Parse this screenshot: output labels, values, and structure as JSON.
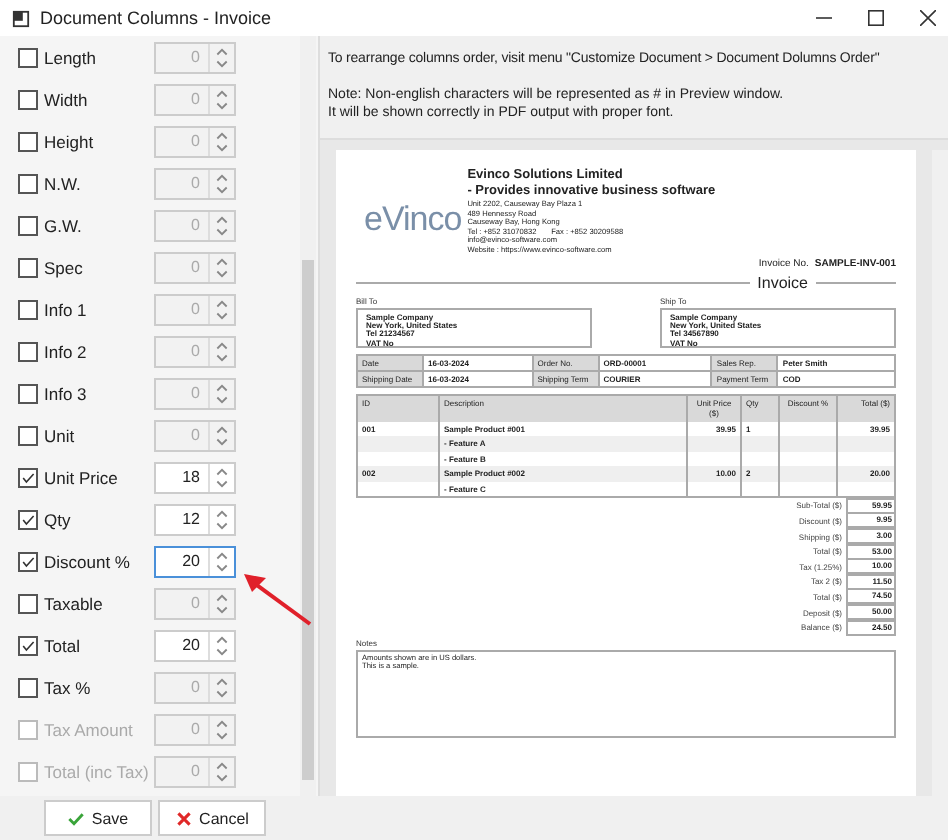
{
  "window": {
    "title": "Document Columns - Invoice"
  },
  "columns": [
    {
      "label": "Length",
      "checked": false,
      "disabled": false,
      "focused": false,
      "value": "0"
    },
    {
      "label": "Width",
      "checked": false,
      "disabled": false,
      "focused": false,
      "value": "0"
    },
    {
      "label": "Height",
      "checked": false,
      "disabled": false,
      "focused": false,
      "value": "0"
    },
    {
      "label": "N.W.",
      "checked": false,
      "disabled": false,
      "focused": false,
      "value": "0"
    },
    {
      "label": "G.W.",
      "checked": false,
      "disabled": false,
      "focused": false,
      "value": "0"
    },
    {
      "label": "Spec",
      "checked": false,
      "disabled": false,
      "focused": false,
      "value": "0"
    },
    {
      "label": "Info 1",
      "checked": false,
      "disabled": false,
      "focused": false,
      "value": "0"
    },
    {
      "label": "Info 2",
      "checked": false,
      "disabled": false,
      "focused": false,
      "value": "0"
    },
    {
      "label": "Info 3",
      "checked": false,
      "disabled": false,
      "focused": false,
      "value": "0"
    },
    {
      "label": "Unit",
      "checked": false,
      "disabled": false,
      "focused": false,
      "value": "0"
    },
    {
      "label": "Unit Price",
      "checked": true,
      "disabled": false,
      "focused": false,
      "value": "18"
    },
    {
      "label": "Qty",
      "checked": true,
      "disabled": false,
      "focused": false,
      "value": "12"
    },
    {
      "label": "Discount %",
      "checked": true,
      "disabled": false,
      "focused": true,
      "value": "20"
    },
    {
      "label": "Taxable",
      "checked": false,
      "disabled": false,
      "focused": false,
      "value": "0"
    },
    {
      "label": "Total",
      "checked": true,
      "disabled": false,
      "focused": false,
      "value": "20"
    },
    {
      "label": "Tax %",
      "checked": false,
      "disabled": false,
      "focused": false,
      "value": "0"
    },
    {
      "label": "Tax Amount",
      "checked": false,
      "disabled": true,
      "focused": false,
      "value": "0"
    },
    {
      "label": "Total (inc Tax)",
      "checked": false,
      "disabled": true,
      "focused": false,
      "value": "0"
    }
  ],
  "info": {
    "hint": "To rearrange columns order, visit menu \"Customize Document > Document Dolumns Order\"",
    "note_1": "Note: Non-english characters will be represented as # in Preview window.",
    "note_2": "It will be shown correctly in PDF output with proper font."
  },
  "invoice": {
    "logo": "eVinco",
    "company": "Evinco Solutions Limited",
    "tagline": "- Provides innovative business software",
    "address": [
      "Unit 2202, Causeway Bay Plaza 1",
      "489 Hennessy Road",
      "Causeway Bay, Hong Kong",
      "Tel : +852 31070832       Fax : +852 30209588",
      "info@evinco-software.com",
      "Website : https://www.evinco-software.com"
    ],
    "number_label": "Invoice No.",
    "number": "SAMPLE-INV-001",
    "title": "Invoice",
    "bill_to": {
      "label": "Bill To",
      "lines": [
        "Sample Company",
        "New York, United States",
        "Tel 21234567",
        "VAT No"
      ]
    },
    "ship_to": {
      "label": "Ship To",
      "lines": [
        "Sample Company",
        "New York, United States",
        "Tel 34567890",
        "VAT No"
      ]
    },
    "details": [
      [
        {
          "label": "Date",
          "value": "16-03-2024"
        },
        {
          "label": "Order No.",
          "value": "ORD-00001"
        },
        {
          "label": "Sales Rep.",
          "value": "Peter Smith"
        }
      ],
      [
        {
          "label": "Shipping Date",
          "value": "16-03-2024"
        },
        {
          "label": "Shipping Term",
          "value": "COURIER"
        },
        {
          "label": "Payment Term",
          "value": "COD"
        }
      ]
    ],
    "columns": [
      "ID",
      "Description",
      "Unit Price ($)",
      "Qty",
      "Discount %",
      "Total ($)"
    ],
    "rows": [
      {
        "id": "001",
        "description": "Sample Product #001",
        "unit_price": "39.95",
        "qty": "1",
        "total": "39.95"
      },
      {
        "description": "- Feature A"
      },
      {
        "description": "- Feature B"
      },
      {
        "id": "002",
        "description": "Sample Product #002",
        "unit_price": "10.00",
        "qty": "2",
        "total": "20.00"
      },
      {
        "description": "- Feature C"
      }
    ],
    "totals": [
      {
        "label": "Sub-Total ($)",
        "value": "59.95"
      },
      {
        "label": "Discount ($)",
        "value": "9.95"
      },
      {
        "label": "Shipping ($)",
        "value": "3.00"
      },
      {
        "label": "Total ($)",
        "value": "53.00"
      },
      {
        "label": "Tax (1.25%)",
        "value": "10.00"
      },
      {
        "label": "Tax 2 ($)",
        "value": "11.50"
      },
      {
        "label": "Total ($)",
        "value": "74.50"
      },
      {
        "label": "Deposit ($)",
        "value": "50.00"
      },
      {
        "label": "Balance ($)",
        "value": "24.50"
      }
    ],
    "notes_label": "Notes",
    "notes": [
      "Amounts shown are in US dollars.",
      "This is a sample."
    ]
  },
  "buttons": [
    {
      "label": "Save",
      "kind": "save"
    },
    {
      "label": "Cancel",
      "kind": "cancel"
    }
  ]
}
